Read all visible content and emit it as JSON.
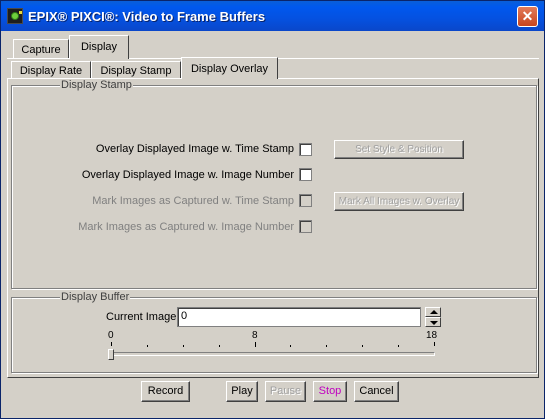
{
  "window": {
    "title": "EPIX® PIXCI®: Video to Frame Buffers",
    "close_glyph": "✕"
  },
  "tabs_top": [
    {
      "label": "Capture",
      "active": false
    },
    {
      "label": "Display",
      "active": true
    }
  ],
  "tabs_sub": [
    {
      "label": "Display Rate",
      "active": false
    },
    {
      "label": "Display Stamp",
      "active": false
    },
    {
      "label": "Display Overlay",
      "active": true
    }
  ],
  "stamp_group": {
    "legend": "Display Stamp",
    "rows": [
      {
        "label": "Overlay Displayed Image w. Time Stamp",
        "enabled": true,
        "checked": false
      },
      {
        "label": "Overlay Displayed Image w. Image Number",
        "enabled": true,
        "checked": false
      },
      {
        "label": "Mark Images as Captured w. Time Stamp",
        "enabled": false,
        "checked": false
      },
      {
        "label": "Mark Images as Captured w. Image Number",
        "enabled": false,
        "checked": false
      }
    ],
    "set_style_button": "Set Style & Position",
    "mark_all_button": "Mark All Images w. Overlay"
  },
  "buffer_group": {
    "legend": "Display Buffer",
    "current_image_label": "Current Image",
    "current_image_value": "0",
    "slider_min_label": "0",
    "slider_mid_label": "8",
    "slider_max_label": "18",
    "slider_value": 0
  },
  "bottom_buttons": {
    "record": "Record",
    "play": "Play",
    "pause": "Pause",
    "stop": "Stop",
    "cancel": "Cancel"
  },
  "colors": {
    "stop_text": "#C000C0",
    "titlebar": "#0058EE"
  },
  "icons": [
    "app-icon",
    "close-icon",
    "spin-up-icon",
    "spin-down-icon"
  ]
}
